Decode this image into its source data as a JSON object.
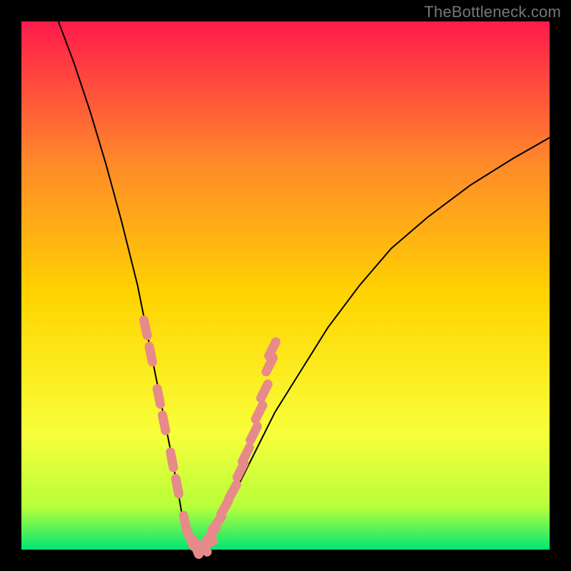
{
  "watermark": "TheBottleneck.com",
  "chart_data": {
    "type": "line",
    "title": "",
    "xlabel": "",
    "ylabel": "",
    "xlim": [
      0,
      100
    ],
    "ylim": [
      0,
      100
    ],
    "grid": false,
    "legend": false,
    "background_gradient": {
      "top": "#ff1a4b",
      "q1": "#ff8a2a",
      "mid": "#ffd400",
      "q3": "#f8ff3a",
      "near_bottom": "#b6ff3a",
      "bottom": "#00e676"
    },
    "series": [
      {
        "name": "bottleneck-curve",
        "color": "#000000",
        "stroke_width": 2,
        "comment": "V-shaped curve; y is the bottleneck magnitude (0 at optimum). Values estimated from pixel positions relative to the gradient plot area.",
        "x": [
          7,
          10,
          13,
          16,
          19,
          22,
          24,
          26,
          28,
          29.5,
          30.5,
          31.5,
          33,
          34,
          35,
          37,
          40,
          44,
          48,
          53,
          58,
          64,
          70,
          77,
          85,
          93,
          100
        ],
        "y": [
          100,
          92,
          83,
          73,
          62,
          50,
          40,
          30,
          20,
          12,
          6,
          2,
          0,
          0,
          1,
          4,
          10,
          18,
          26,
          34,
          42,
          50,
          57,
          63,
          69,
          74,
          78
        ]
      }
    ],
    "optimum_x": 33.5,
    "markers": {
      "comment": "Salmon rounded-capsule tick marks hugging the curve near its minimum on both arms.",
      "color": "#e78a8a",
      "points": [
        {
          "x": 23.5,
          "y": 42
        },
        {
          "x": 24.5,
          "y": 37
        },
        {
          "x": 26,
          "y": 29
        },
        {
          "x": 27,
          "y": 24
        },
        {
          "x": 28.5,
          "y": 17
        },
        {
          "x": 29.5,
          "y": 12
        },
        {
          "x": 31,
          "y": 5
        },
        {
          "x": 32,
          "y": 2
        },
        {
          "x": 33,
          "y": 0.5
        },
        {
          "x": 34,
          "y": 0.5
        },
        {
          "x": 35,
          "y": 1
        },
        {
          "x": 36,
          "y": 3
        },
        {
          "x": 37,
          "y": 5
        },
        {
          "x": 38.5,
          "y": 8
        },
        {
          "x": 40,
          "y": 11
        },
        {
          "x": 41.5,
          "y": 15
        },
        {
          "x": 42.5,
          "y": 18
        },
        {
          "x": 44,
          "y": 22
        },
        {
          "x": 45,
          "y": 26
        },
        {
          "x": 46,
          "y": 30
        },
        {
          "x": 47,
          "y": 35
        },
        {
          "x": 47.5,
          "y": 38
        }
      ]
    }
  }
}
